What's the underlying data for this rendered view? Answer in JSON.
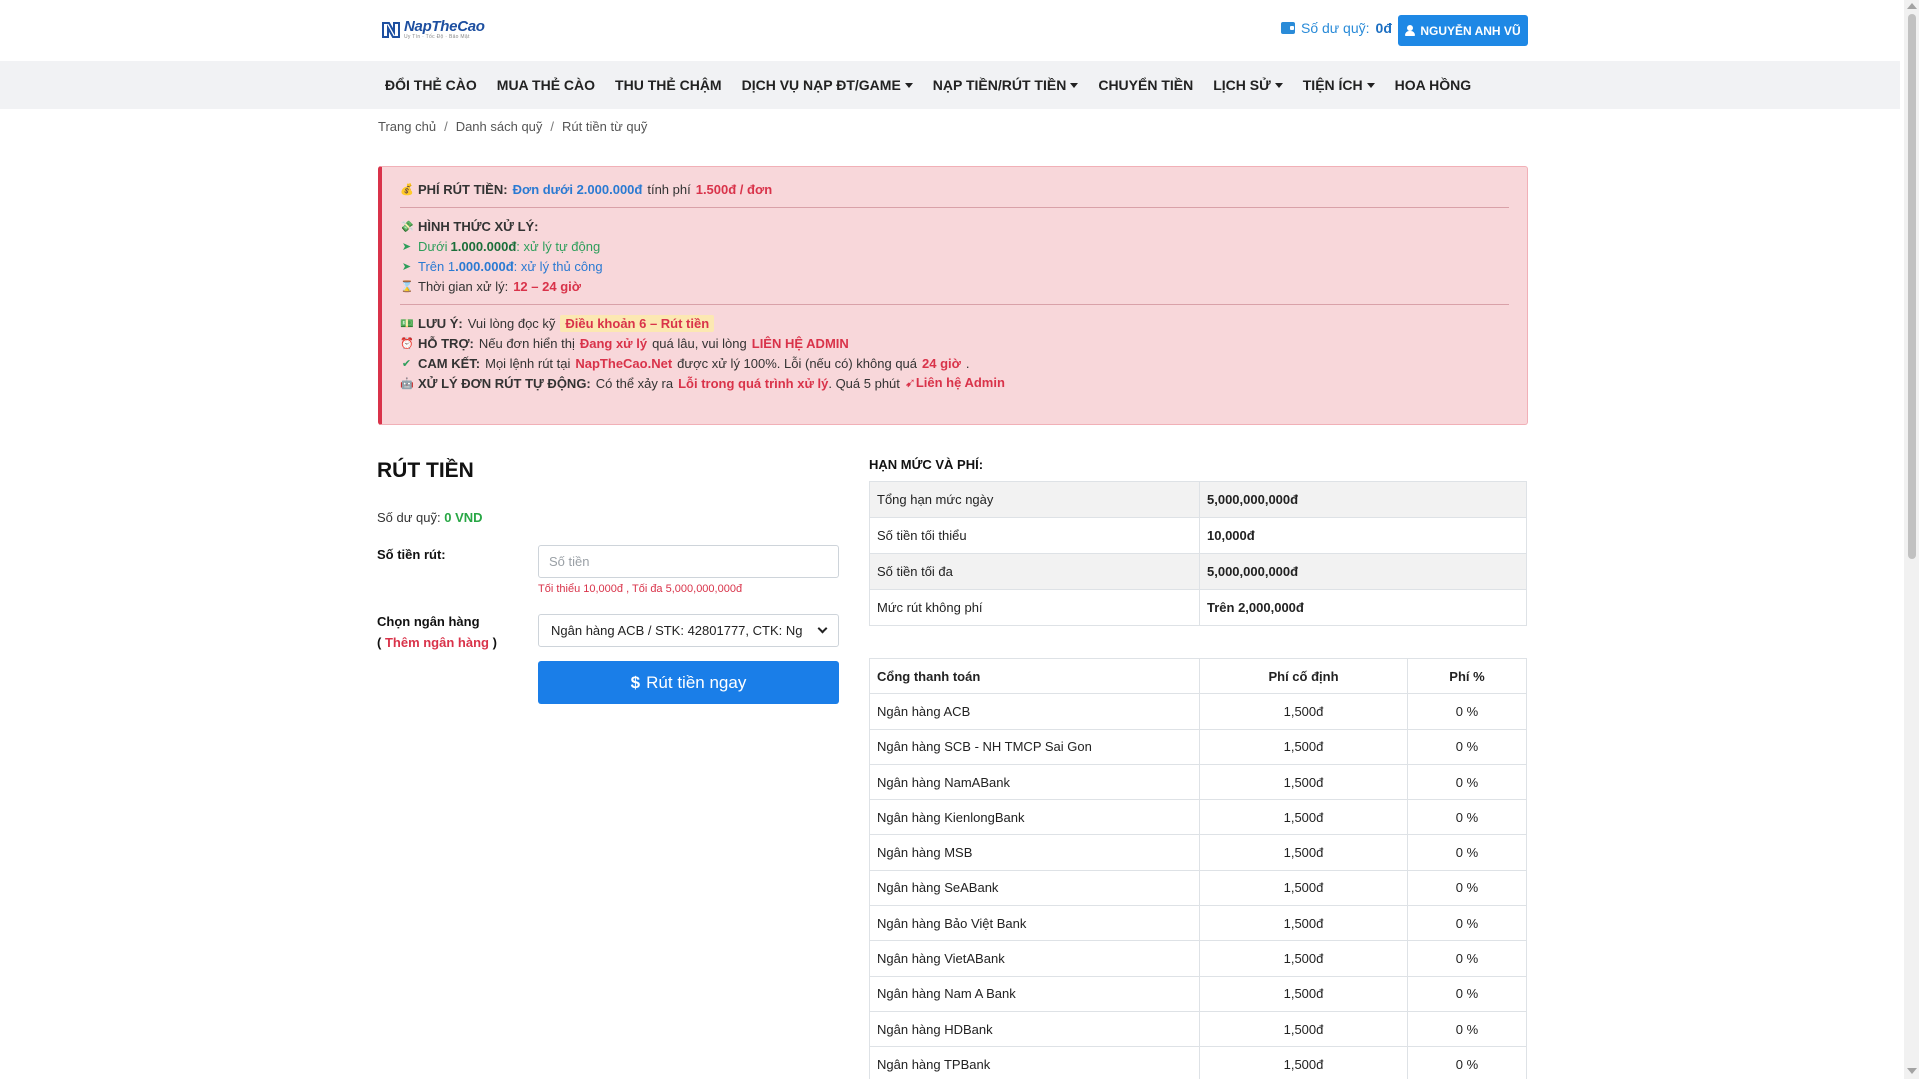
{
  "header": {
    "logo_text": "NapTheCao",
    "logo_sub": "Uy Tín · Tốc Độ · Bảo Mật",
    "balance_label": "Số dư quỹ:",
    "balance_value": "0đ",
    "user_name": "NGUYỄN ANH VŨ"
  },
  "nav": [
    {
      "label": "ĐỔI THẺ CÀO",
      "dropdown": false
    },
    {
      "label": "MUA THẺ CÀO",
      "dropdown": false
    },
    {
      "label": "THU THẺ CHẬM",
      "dropdown": false
    },
    {
      "label": "DỊCH VỤ NẠP ĐT/GAME",
      "dropdown": true
    },
    {
      "label": "NẠP TIỀN/RÚT TIỀN",
      "dropdown": true
    },
    {
      "label": "CHUYỂN TIỀN",
      "dropdown": false
    },
    {
      "label": "LỊCH SỬ",
      "dropdown": true
    },
    {
      "label": "TIỆN ÍCH",
      "dropdown": true
    },
    {
      "label": "HOA HỒNG",
      "dropdown": false
    }
  ],
  "breadcrumb": [
    "Trang chủ",
    "Danh sách quỹ",
    "Rút tiền từ quỹ"
  ],
  "alert": {
    "fee_label": "PHÍ RÚT TIỀN:",
    "fee_cond": "Đơn dưới 2.000.000đ",
    "fee_text": "tính phí",
    "fee_value": "1.500đ / đơn",
    "process_label": "HÌNH THỨC XỬ LÝ:",
    "under_prefix": "Dưới",
    "under_amount": "1.000.000đ",
    "under_text": ": xử lý tự động",
    "over_prefix": "Trên 1",
    "over_amount": ".000.000đ",
    "over_text": ": xử lý thủ công",
    "time_label": "Thời gian xử lý:",
    "time_value": "12 – 24 giờ",
    "note_label": "LƯU Ý:",
    "note_text": "Vui lòng đọc kỹ",
    "note_tag": "Điều khoản 6 – Rút tiền",
    "support_label": "HỖ TRỢ:",
    "support_text1": "Nếu đơn hiển thị",
    "support_status": "Đang xử lý",
    "support_text2": "quá lâu, vui lòng",
    "support_contact": "LIÊN HỆ ADMIN",
    "commit_label": "CAM KẾT:",
    "commit_text1": "Mọi lệnh rút tại",
    "commit_site": "NapTheCao.Net",
    "commit_text2": "được xử lý 100%. Lỗi (nếu có) không quá",
    "commit_time": "24 giờ",
    "auto_label": "XỬ LÝ ĐƠN RÚT TỰ ĐỘNG:",
    "auto_text1": "Có thể xảy ra",
    "auto_error": "Lỗi trong quá trình xử lý",
    "auto_text2": ". Quá 5 phút",
    "auto_contact": "Liên hệ Admin"
  },
  "form": {
    "title": "RÚT TIỀN",
    "fund_label": "Số dư quỹ:",
    "fund_value": "0 VND",
    "amount_label": "Số tiền rút:",
    "amount_placeholder": "Số tiền",
    "amount_hint": "Tối thiểu 10,000đ , Tối đa 5,000,000,000đ",
    "bank_label": "Chọn ngân hàng",
    "add_bank": "Thêm ngân hàng",
    "bank_selected": "Ngân hàng ACB / STK: 42801777, CTK: Ng",
    "submit_label": "Rút tiền ngay"
  },
  "limits": {
    "title": "HẠN MỨC VÀ PHÍ:",
    "rows": [
      [
        "Tổng hạn mức ngày",
        "5,000,000,000đ"
      ],
      [
        "Số tiền tối thiểu",
        "10,000đ"
      ],
      [
        "Số tiền tối đa",
        "5,000,000,000đ"
      ],
      [
        "Mức rút không phí",
        "Trên 2,000,000đ"
      ]
    ]
  },
  "fees": {
    "headers": [
      "Cổng thanh toán",
      "Phí cố định",
      "Phí %"
    ],
    "rows": [
      [
        "Ngân hàng ACB",
        "1,500đ",
        "0 %"
      ],
      [
        "Ngân hàng SCB - NH TMCP Sai Gon",
        "1,500đ",
        "0 %"
      ],
      [
        "Ngân hàng NamABank",
        "1,500đ",
        "0 %"
      ],
      [
        "Ngân hàng KienlongBank",
        "1,500đ",
        "0 %"
      ],
      [
        "Ngân hàng MSB",
        "1,500đ",
        "0 %"
      ],
      [
        "Ngân hàng SeABank",
        "1,500đ",
        "0 %"
      ],
      [
        "Ngân hàng Bảo Việt Bank",
        "1,500đ",
        "0 %"
      ],
      [
        "Ngân hàng VietABank",
        "1,500đ",
        "0 %"
      ],
      [
        "Ngân hàng Nam A Bank",
        "1,500đ",
        "0 %"
      ],
      [
        "Ngân hàng HDBank",
        "1,500đ",
        "0 %"
      ],
      [
        "Ngân hàng TPBank",
        "1,500đ",
        "0 %"
      ]
    ]
  },
  "colors": {
    "primary": "#1a7ee8",
    "alert_bg": "#f8d7da",
    "alert_border": "#d9334a",
    "success": "#28a745"
  }
}
